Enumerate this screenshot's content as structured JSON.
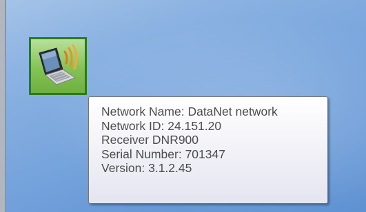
{
  "tray_icon": {
    "icon": "laptop-wireless-icon"
  },
  "tooltip": {
    "network_name": "Network Name: DataNet network",
    "network_id": "Network ID: 24.151.20",
    "receiver": "Receiver DNR900",
    "serial_number": "Serial Number: 701347",
    "version": "Version: 3.1.2.45"
  },
  "colors": {
    "icon_border": "#2b7a1c",
    "icon_background": "#84c255",
    "wave_color": "#e07a18",
    "desktop_blue": "#7ca8de",
    "tooltip_text": "#4c4c4c"
  }
}
